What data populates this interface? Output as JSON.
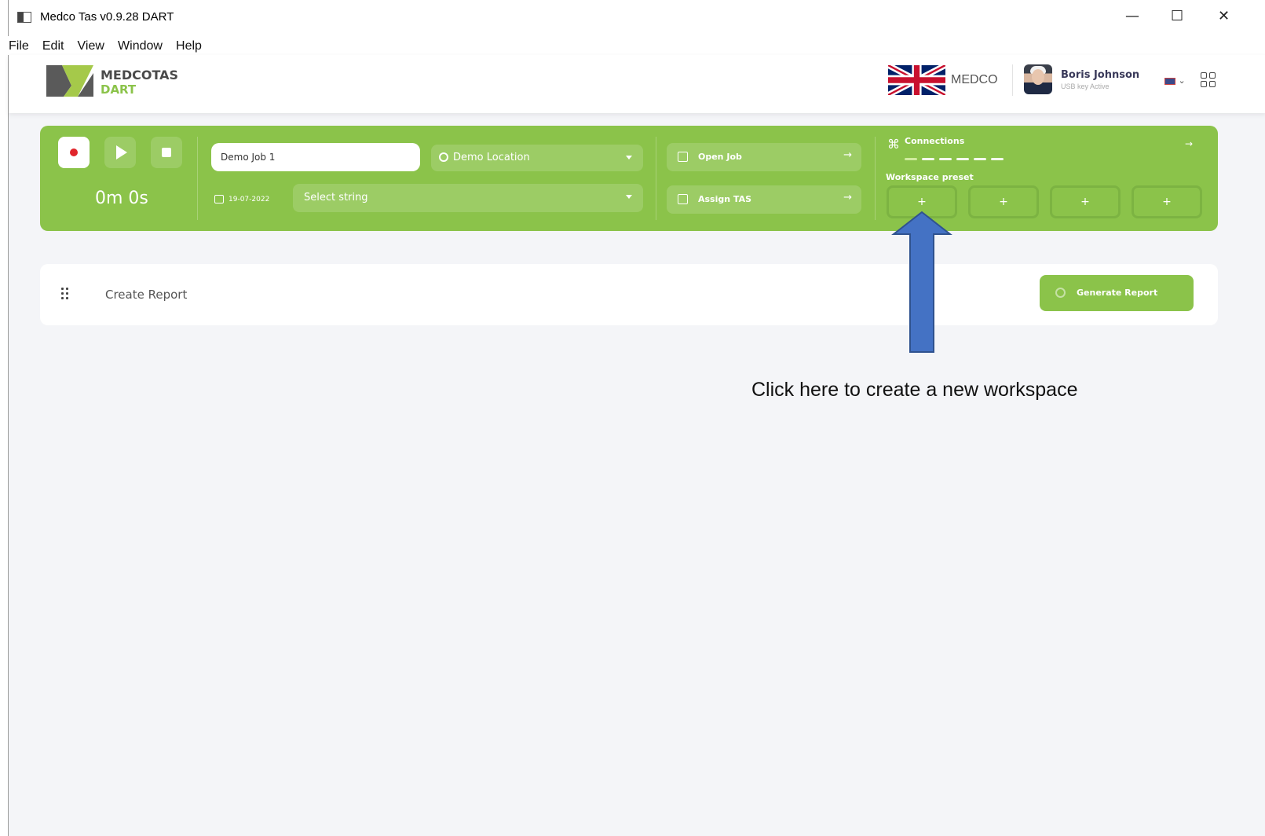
{
  "window": {
    "title": "Medco Tas v0.9.28  DART",
    "minimize": "—",
    "maximize": "☐",
    "close": "✕"
  },
  "menu": [
    "File",
    "Edit",
    "View",
    "Window",
    "Help"
  ],
  "header": {
    "logo_line1": "MEDCOTAS",
    "logo_line2": "DART",
    "org_label": "MEDCO",
    "user_name": "Boris Johnson",
    "user_status": "USB key Active",
    "lang_caret": "⌄"
  },
  "control_panel": {
    "timer": "0m 0s",
    "job_name": "Demo Job 1",
    "location": "Demo Location",
    "date": "19-07-2022",
    "string_placeholder": "Select string",
    "open_job": "Open Job",
    "assign_tas": "Assign TAS",
    "arrow": "→",
    "connections_label": "Connections",
    "workspace_preset_label": "Workspace preset",
    "workspace_buttons": [
      "+",
      "+",
      "+",
      "+"
    ]
  },
  "report_card": {
    "label": "Create Report",
    "generate_button": "Generate Report"
  },
  "annotation": {
    "text": "Click here to create a new workspace",
    "arrow_color": "#4472c4"
  },
  "colors": {
    "accent_green": "#8bc34a",
    "record_red": "#e0252b"
  }
}
